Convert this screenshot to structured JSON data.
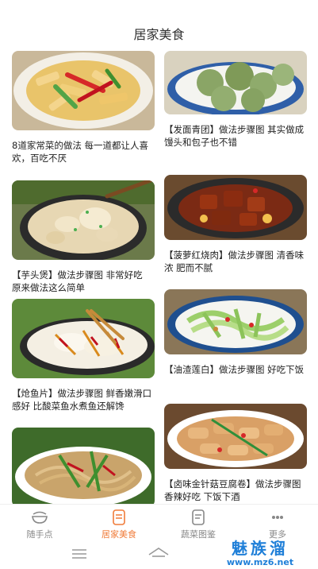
{
  "header": {
    "title": "居家美食"
  },
  "feed": {
    "left": [
      {
        "caption": "8道家常菜的做法 每一道都让人喜欢，百吃不厌",
        "image": "stir-fried-bamboo-shoots-photo"
      },
      {
        "caption": "【芋头煲】做法步骤图 非常好吃 原来做法这么简单",
        "image": "taro-pot-photo"
      },
      {
        "caption": "【炝鱼片】做法步骤图 鲜香嫩滑口感好 比酸菜鱼水煮鱼还解馋",
        "image": "spicy-fish-fillet-photo"
      },
      {
        "caption": "",
        "image": "stir-fried-noodles-photo"
      }
    ],
    "right": [
      {
        "caption": "【发面青团】做法步骤图 其实做成馒头和包子也不错",
        "image": "green-buns-photo"
      },
      {
        "caption": "【菠萝红烧肉】做法步骤图 清香味浓 肥而不腻",
        "image": "braised-pork-photo"
      },
      {
        "caption": "【油渣莲白】做法步骤图 好吃下饭",
        "image": "cabbage-stir-fry-photo"
      },
      {
        "caption": "【卤味金针菇豆腐卷】做法步骤图 香辣好吃 下饭下酒",
        "image": "enoki-tofu-rolls-photo"
      }
    ]
  },
  "tabbar": {
    "tabs": [
      {
        "label": "随手点",
        "icon": "bowl-icon",
        "active": false
      },
      {
        "label": "居家美食",
        "icon": "document-icon",
        "active": true
      },
      {
        "label": "蔬菜图鉴",
        "icon": "book-icon",
        "active": false
      },
      {
        "label": "更多",
        "icon": "more-icon",
        "active": false
      }
    ]
  },
  "system_nav": {
    "icons": [
      "menu-icon",
      "home-icon"
    ]
  },
  "watermark": {
    "main": "魅族溜",
    "sub": "www.mz6.net"
  },
  "colors": {
    "accent": "#f07c3a",
    "inactive": "#888888",
    "watermark": "#1f7fd8"
  }
}
